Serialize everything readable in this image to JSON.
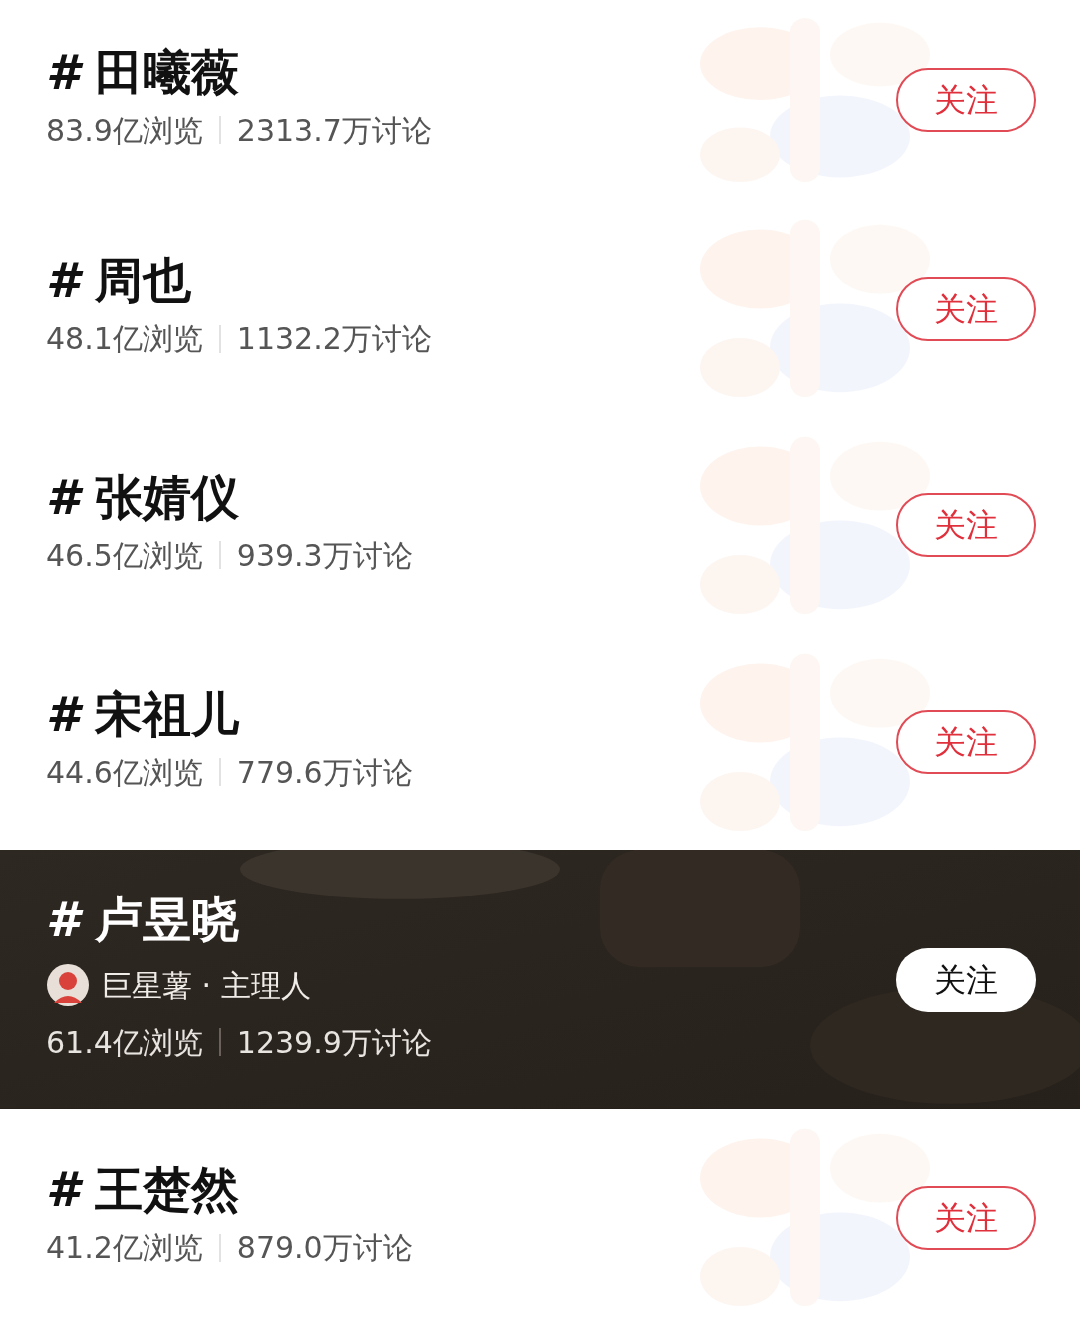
{
  "topics": [
    {
      "kind": "plain",
      "mark": "#",
      "name": "田曦薇",
      "views": "83.9亿浏览",
      "discussions": "2313.7万讨论",
      "follow": "关注"
    },
    {
      "kind": "plain",
      "mark": "#",
      "name": "周也",
      "views": "48.1亿浏览",
      "discussions": "1132.2万讨论",
      "follow": "关注"
    },
    {
      "kind": "plain",
      "mark": "#",
      "name": "张婧仪",
      "views": "46.5亿浏览",
      "discussions": "939.3万讨论",
      "follow": "关注"
    },
    {
      "kind": "plain",
      "mark": "#",
      "name": "宋祖儿",
      "views": "44.6亿浏览",
      "discussions": "779.6万讨论",
      "follow": "关注"
    },
    {
      "kind": "featured",
      "mark": "#",
      "name": "卢昱晓",
      "host": "巨星薯 · 主理人",
      "views": "61.4亿浏览",
      "discussions": "1239.9万讨论",
      "follow": "关注"
    },
    {
      "kind": "plain",
      "mark": "#",
      "name": "王楚然",
      "views": "41.2亿浏览",
      "discussions": "879.0万讨论",
      "follow": "关注"
    }
  ]
}
